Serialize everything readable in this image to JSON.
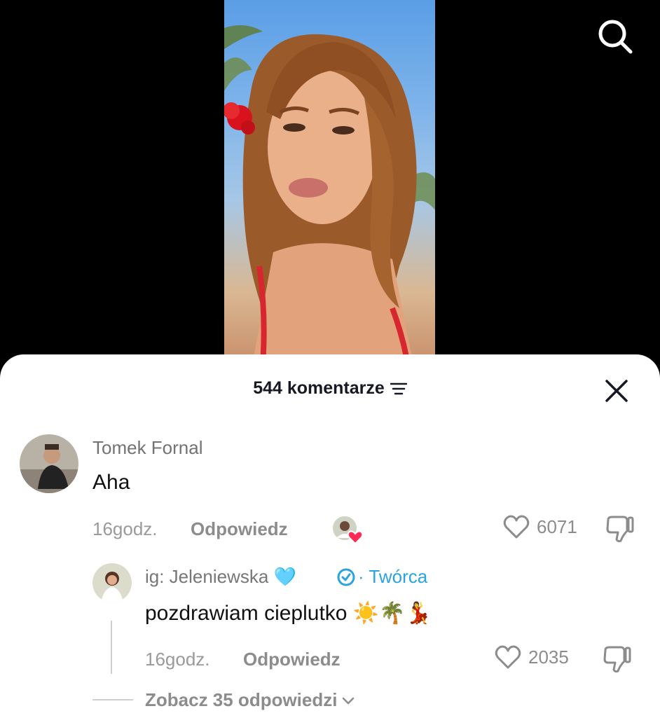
{
  "sheet": {
    "comment_count_label": "544 komentarze"
  },
  "icons": {
    "search": "search-icon",
    "sort": "sort-icon",
    "close": "close-icon",
    "heart": "heart-icon",
    "dislike": "thumbs-down-icon",
    "verified": "verified-badge-icon",
    "chevron": "chevron-down-icon"
  },
  "comments": [
    {
      "username": "Tomek Fornal",
      "text": "Aha",
      "time": "16godz.",
      "reply_label": "Odpowiedz",
      "likes": "6071"
    }
  ],
  "replies": [
    {
      "username": "ig: Jeleniewska 🩵",
      "creator_label": "· Twórca",
      "text": "pozdrawiam cieplutko ☀️🌴💃",
      "time": "16godz.",
      "reply_label": "Odpowiedz",
      "likes": "2035"
    }
  ],
  "more_replies_label": "Zobacz 35 odpowiedzi",
  "colors": {
    "creator_blue": "#2aa3e0",
    "heart_red": "#fe2c55",
    "muted_text": "#8c8c8c"
  }
}
